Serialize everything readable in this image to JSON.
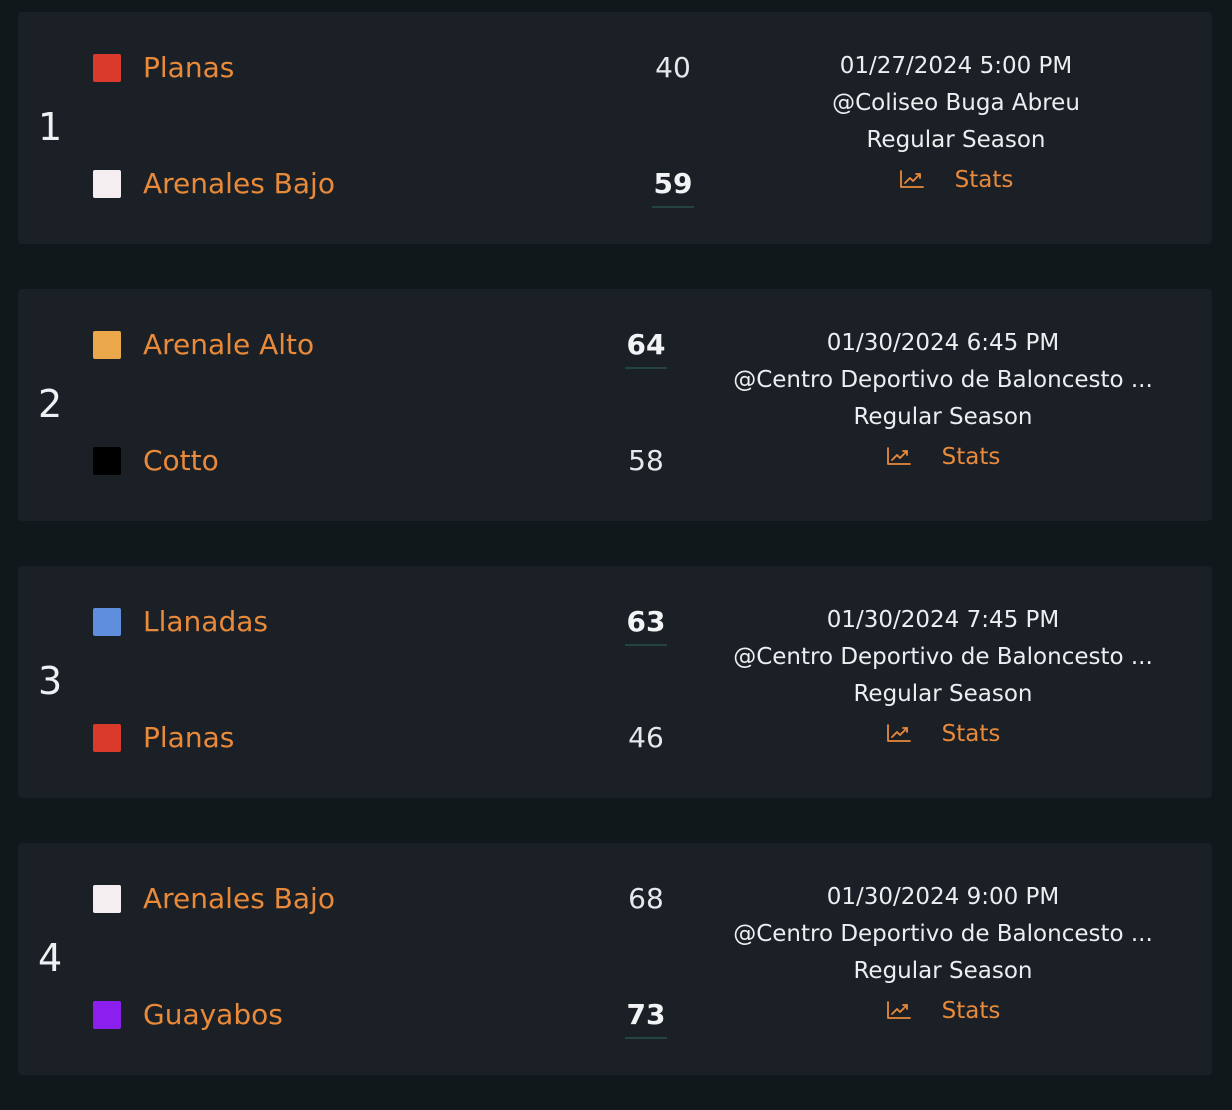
{
  "games": [
    {
      "number": "1",
      "home": {
        "name": "Planas",
        "score": "40",
        "color": "#d93a2b",
        "winner": false
      },
      "away": {
        "name": "Arenales Bajo",
        "score": "59",
        "color": "#f4eef0",
        "winner": true
      },
      "datetime": "01/27/2024 5:00 PM",
      "venue": "@Coliseo Buga Abreu",
      "season": "Regular Season",
      "stats_label": "Stats",
      "stats_icon": "trending-chart-icon"
    },
    {
      "number": "2",
      "home": {
        "name": "Arenale Alto",
        "score": "64",
        "color": "#eaa84a",
        "winner": true
      },
      "away": {
        "name": "Cotto",
        "score": "58",
        "color": "#000000",
        "winner": false
      },
      "datetime": "01/30/2024 6:45 PM",
      "venue": "@Centro Deportivo de Baloncesto ...",
      "season": "Regular Season",
      "stats_label": "Stats",
      "stats_icon": "trending-chart-icon"
    },
    {
      "number": "3",
      "home": {
        "name": "Llanadas",
        "score": "63",
        "color": "#5f8fdc",
        "winner": true
      },
      "away": {
        "name": "Planas",
        "score": "46",
        "color": "#d93a2b",
        "winner": false
      },
      "datetime": "01/30/2024 7:45 PM",
      "venue": "@Centro Deportivo de Baloncesto ...",
      "season": "Regular Season",
      "stats_label": "Stats",
      "stats_icon": "trending-chart-icon"
    },
    {
      "number": "4",
      "home": {
        "name": "Arenales Bajo",
        "score": "68",
        "color": "#f4eef0",
        "winner": false
      },
      "away": {
        "name": "Guayabos",
        "score": "73",
        "color": "#8a1ff0",
        "winner": true
      },
      "datetime": "01/30/2024 9:00 PM",
      "venue": "@Centro Deportivo de Baloncesto ...",
      "season": "Regular Season",
      "stats_label": "Stats",
      "stats_icon": "trending-chart-icon"
    }
  ]
}
